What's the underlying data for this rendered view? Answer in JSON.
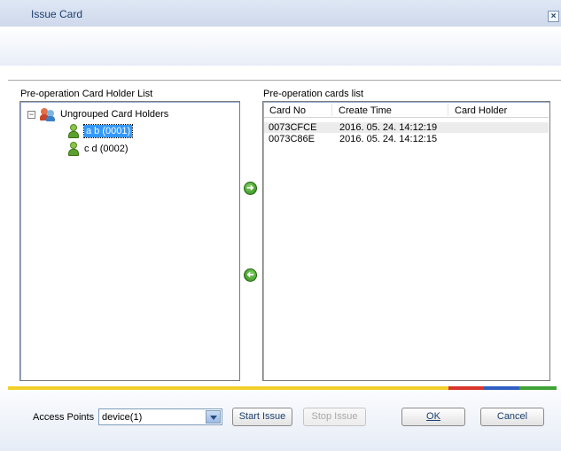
{
  "window": {
    "title": "Issue Card",
    "close_glyph": "×"
  },
  "left_panel": {
    "label": "Pre-operation Card Holder List",
    "tree": {
      "expander": "−",
      "group_label": "Ungrouped Card Holders",
      "items": [
        {
          "label": "a b (0001)",
          "selected": true
        },
        {
          "label": "c d (0002)",
          "selected": false
        }
      ]
    }
  },
  "transfer": {
    "add_glyph": "➜",
    "remove_glyph": "➜"
  },
  "right_panel": {
    "label": "Pre-operation cards list",
    "columns": [
      "Card No",
      "Create Time",
      "Card Holder"
    ],
    "rows": [
      {
        "card_no": "0073CFCE",
        "create_time": "2016. 05. 24. 14:12:19",
        "card_holder": ""
      },
      {
        "card_no": "0073C86E",
        "create_time": "2016. 05. 24. 14:12:15",
        "card_holder": ""
      }
    ]
  },
  "footer": {
    "access_points_label": "Access Points",
    "access_points_value": "device(1)",
    "start_issue": "Start Issue",
    "stop_issue": "Stop Issue",
    "ok": "OK",
    "cancel": "Cancel"
  },
  "colors": {
    "strip_yellow": "#f2cf2a",
    "strip_red": "#d9352b",
    "strip_blue": "#2f5fc4",
    "strip_green": "#3fa336"
  }
}
